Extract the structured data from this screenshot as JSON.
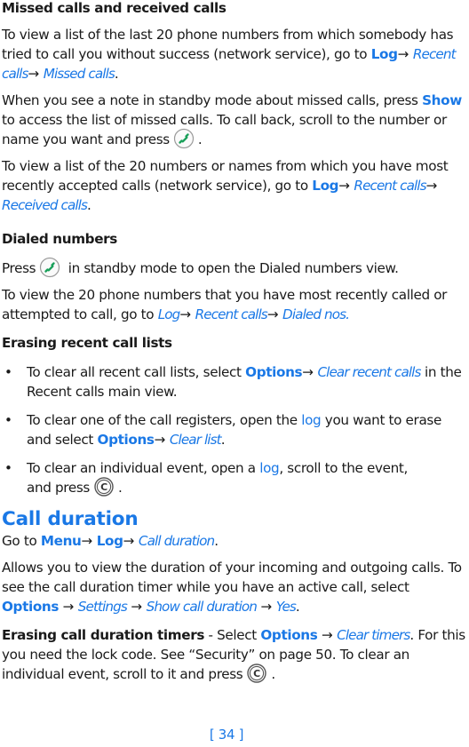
{
  "sections": {
    "missed_received": {
      "heading": "Missed calls and received calls",
      "p1": {
        "text": "To view a list of the last 20 phone numbers from which somebody has tried to call you without success (network service), go to ",
        "path": [
          "Log",
          "Recent calls",
          "Missed calls"
        ],
        "end": "."
      },
      "p2": {
        "text_before_show": "When you see a note in standby mode about missed calls, press ",
        "show": "Show",
        "text_after_show": " to access the list of missed calls. To call back, scroll to the number or name you want and press",
        "end": ".",
        "icon": "call-key-icon"
      },
      "p3": {
        "text": "To view a list of the 20 numbers or names from which you have most recently accepted calls (network service), go to ",
        "path": [
          "Log",
          "Recent calls",
          "Received calls"
        ],
        "end": "."
      }
    },
    "dialed": {
      "heading": "Dialed numbers",
      "p1": {
        "before": "Press",
        "after": "in standby mode to open the Dialed numbers view.",
        "icon": "call-key-icon"
      },
      "p2": {
        "text": "To view the 20 phone numbers that you have most recently called or attempted to call, go to ",
        "path": [
          "Log",
          "Recent calls",
          "Dialed nos."
        ]
      }
    },
    "erasing": {
      "heading": "Erasing recent call lists",
      "bullets": [
        {
          "before": "To clear all recent call lists, select ",
          "bold": "Options",
          "italic": "Clear recent calls",
          "after": " in the Recent calls main view."
        },
        {
          "before": "To clear one of the call registers, open the ",
          "link": "log",
          "mid": " you want to erase and select ",
          "bold": "Options",
          "italic": "Clear list",
          "after": "."
        },
        {
          "before": "To clear an individual event, open a ",
          "link": "log",
          "mid": ", scroll to the event,",
          "line2": "and press",
          "end": ".",
          "icon": "clear-key-icon"
        }
      ]
    },
    "call_duration": {
      "heading": "Call duration",
      "goto": {
        "before": "Go to ",
        "bold1": "Menu",
        "bold2": "Log",
        "italic": "Call duration",
        "end": "."
      },
      "p1": {
        "text": "Allows you to view the duration of your incoming and outgoing calls. To see the call duration timer while you have an active call, select",
        "bold": "Options",
        "path": [
          "Settings",
          "Show call duration",
          "Yes"
        ],
        "end": "."
      },
      "p2": {
        "bold_lead": "Erasing call duration timers",
        "dash": " - Select ",
        "bold": "Options",
        "italic": "Clear timers",
        "text": ". For this you need the lock code. See “Security” on page 50. To clear an individual event, scroll to it and press",
        "end": ".",
        "icon": "clear-key-icon"
      }
    }
  },
  "arrow": "→",
  "bullet": "•",
  "page_number": "[ 34 ]",
  "colors": {
    "accent": "#1a78e6",
    "text": "#1a1a1a",
    "call_key_green": "#1aa05a"
  }
}
